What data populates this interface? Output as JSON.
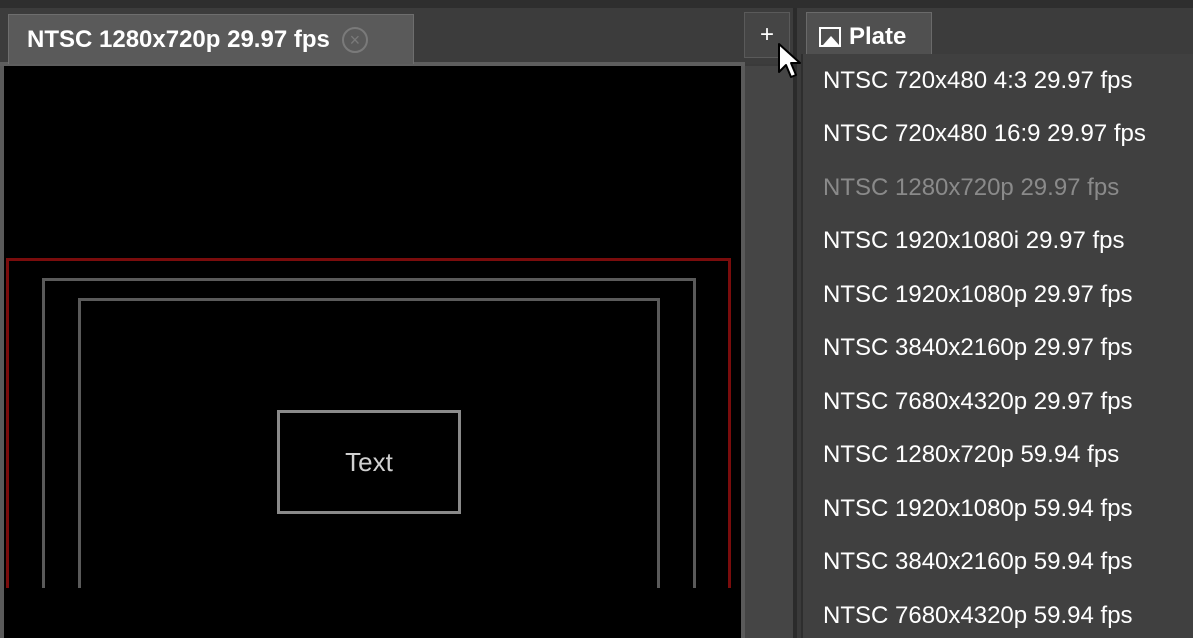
{
  "tabs": {
    "active_label": "NTSC 1280x720p 29.97 fps",
    "close_glyph": "×",
    "add_glyph": "+",
    "plate_label": "Plate"
  },
  "viewport": {
    "text_label": "Text"
  },
  "menu": {
    "items": [
      {
        "label": "NTSC 720x480 4:3 29.97 fps",
        "enabled": true
      },
      {
        "label": "NTSC 720x480 16:9 29.97 fps",
        "enabled": true
      },
      {
        "label": "NTSC 1280x720p 29.97 fps",
        "enabled": false
      },
      {
        "label": "NTSC 1920x1080i 29.97 fps",
        "enabled": true
      },
      {
        "label": "NTSC 1920x1080p 29.97 fps",
        "enabled": true
      },
      {
        "label": "NTSC 3840x2160p 29.97 fps",
        "enabled": true
      },
      {
        "label": "NTSC 7680x4320p 29.97 fps",
        "enabled": true
      },
      {
        "label": "NTSC 1280x720p 59.94 fps",
        "enabled": true
      },
      {
        "label": "NTSC 1920x1080p 59.94 fps",
        "enabled": true
      },
      {
        "label": "NTSC 3840x2160p 59.94 fps",
        "enabled": true
      },
      {
        "label": "NTSC 7680x4320p 59.94 fps",
        "enabled": true
      }
    ]
  },
  "colors": {
    "safe_area_red": "#7a0c0c",
    "disabled_text": "#8a8a8a"
  },
  "icons": {
    "plate": "image-icon",
    "close": "close-circle-icon",
    "cursor": "mouse-pointer-icon"
  }
}
